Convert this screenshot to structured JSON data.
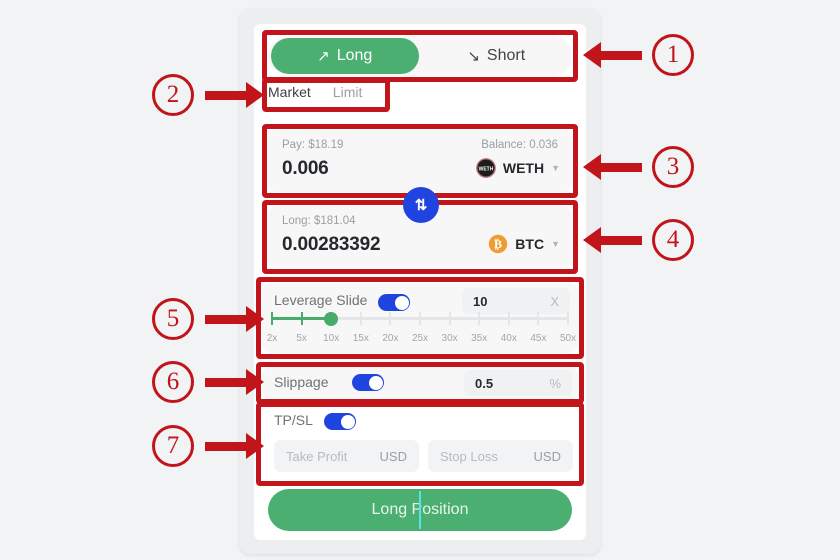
{
  "side_toggle": {
    "long": {
      "label": "Long",
      "icon": "arrow-up-right-icon",
      "glyph": "↗",
      "active": true
    },
    "short": {
      "label": "Short",
      "icon": "arrow-down-right-icon",
      "glyph": "↘",
      "active": false
    }
  },
  "order_types": [
    {
      "label": "Market",
      "active": true
    },
    {
      "label": "Limit",
      "active": false
    }
  ],
  "pay_field": {
    "left_label": "Pay: $18.19",
    "right_label": "Balance: 0.036",
    "amount": "0.006",
    "token": "WETH",
    "token_icon": "weth-token-icon",
    "caret": "▼"
  },
  "swap": {
    "icon": "swap-arrows-icon",
    "glyph": "⇅",
    "color": "#1f44e0"
  },
  "long_field": {
    "left_label": "Long: $181.04",
    "right_label": "",
    "amount": "0.00283392",
    "token": "BTC",
    "token_icon": "btc-token-icon",
    "caret": "▼"
  },
  "leverage": {
    "label": "Leverage Slide",
    "toggle_on": true,
    "value": "10",
    "unit": "X",
    "selected": "10x",
    "ticks": [
      "2x",
      "5x",
      "10x",
      "15x",
      "20x",
      "25x",
      "30x",
      "35x",
      "40x",
      "45x",
      "50x"
    ],
    "fill_color": "#49ab6b"
  },
  "slippage": {
    "label": "Slippage",
    "toggle_on": true,
    "value": "0.5",
    "unit": "%"
  },
  "tpsl": {
    "label": "TP/SL",
    "toggle_on": true,
    "take_profit_placeholder": "Take Profit",
    "take_profit_currency": "USD",
    "stop_loss_placeholder": "Stop Loss",
    "stop_loss_currency": "USD"
  },
  "submit": {
    "label": "Long Position",
    "color": "#4caf72"
  },
  "annotations": {
    "accent": "#c1141b",
    "numbers": [
      "①",
      "②",
      "③",
      "④",
      "⑤",
      "⑥",
      "⑦"
    ],
    "labels": [
      "1",
      "2",
      "3",
      "4",
      "5",
      "6",
      "7"
    ]
  }
}
